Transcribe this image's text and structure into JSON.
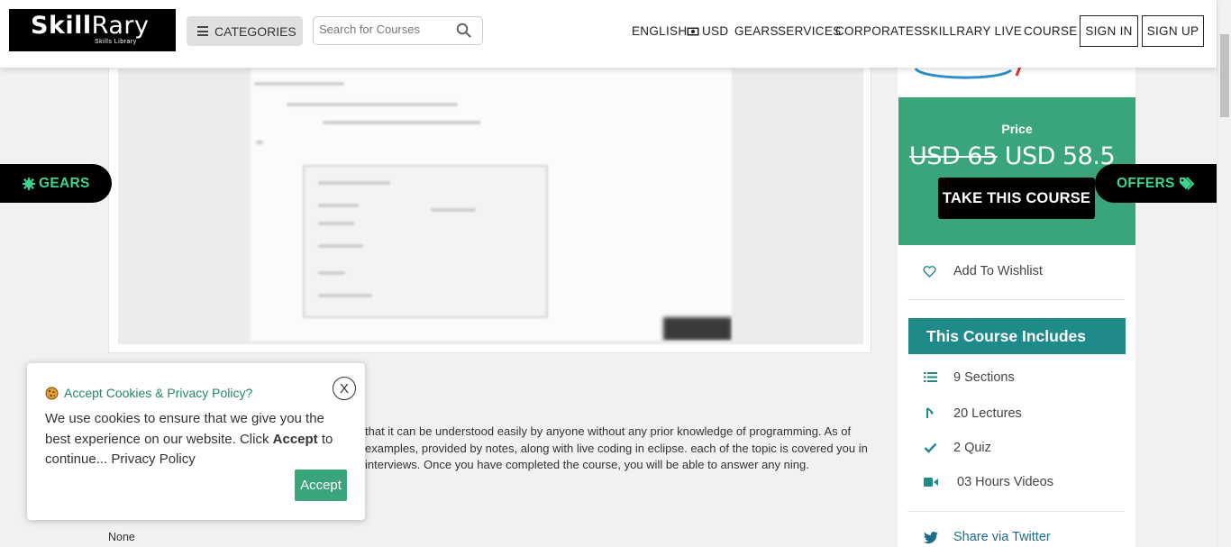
{
  "header": {
    "logo_main_a": "Skill",
    "logo_main_b": "Rary",
    "logo_sub": "Skills Library",
    "categories_label": "CATEGORIES",
    "search_placeholder": "Search for Courses",
    "nav": {
      "english": "ENGLISH",
      "usd": "USD",
      "gears": "GEARS",
      "services": "SERVICES",
      "corporates": "CORPORATES",
      "skillrary_live": "SKILLRARY LIVE",
      "course": "COURSE",
      "sign_in": "SIGN IN",
      "sign_up": "SIGN UP"
    }
  },
  "main": {
    "description": "that it can be understood easily by anyone without any prior knowledge of programming. As of examples, provided by notes, along with live coding in eclipse. each of the topic is covered you in interviews. Once you have completed the course, you will be able to answer any ning.",
    "none_text": "None"
  },
  "sidebar": {
    "price_label": "Price",
    "price_old": "USD 65",
    "price_new": "USD 58.5",
    "take_course": "TAKE THIS COURSE",
    "wishlist": "Add To Wishlist",
    "includes_title": "This Course Includes",
    "includes": [
      {
        "icon": "list-icon",
        "label": "9 Sections"
      },
      {
        "icon": "lecture-icon",
        "label": "20 Lectures"
      },
      {
        "icon": "check-icon",
        "label": "2 Quiz"
      },
      {
        "icon": "video-icon",
        "label": "03 Hours Videos"
      }
    ],
    "share_twitter": "Share via Twitter"
  },
  "side_tabs": {
    "gears": "GEARS",
    "offers": "OFFERS"
  },
  "cookie": {
    "title": "Accept Cookies & Privacy Policy?",
    "close": "X",
    "body_1": "We use cookies to ensure that we give you the best experience on our website. Click ",
    "body_bold": "Accept",
    "body_2": " to continue... Privacy Policy",
    "accept": "Accept"
  },
  "colors": {
    "green": "#3aa57a",
    "teal": "#1f8a8a",
    "tab_text": "#3ed48f"
  }
}
